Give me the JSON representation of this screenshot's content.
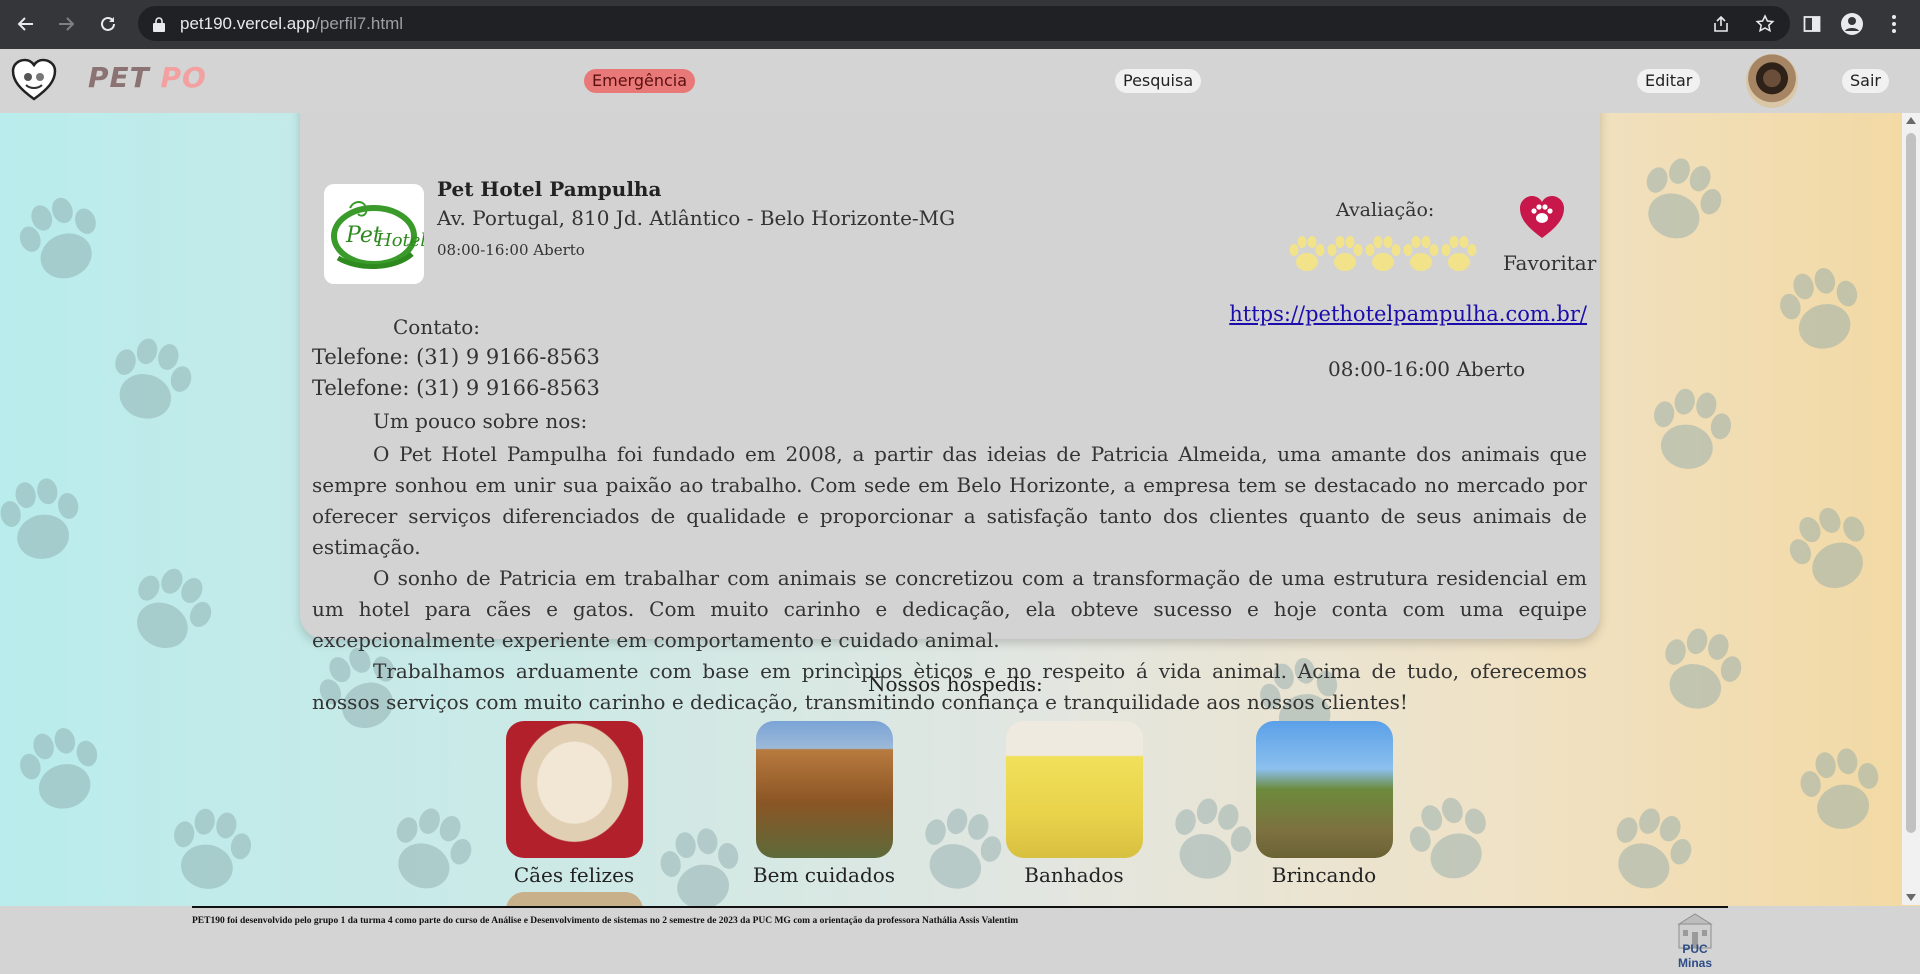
{
  "browser": {
    "url_host": "pet190.vercel.app",
    "url_path": "/perfil7.html"
  },
  "header": {
    "logo_part1": "PET",
    "logo_part2": "PO",
    "emergency": "Emergência",
    "search": "Pesquisa",
    "edit": "Editar",
    "logout": "Sair"
  },
  "profile": {
    "name": "Pet Hotel Pampulha",
    "address": "Av. Portugal, 810 Jd. Atlântico - Belo Horizonte-MG",
    "hours_small": "08:00-16:00 Aberto",
    "rating_label": "Avaliação:",
    "rating_value": 5,
    "favorite_label": "Favoritar",
    "website": "https://pethotelpampulha.com.br/",
    "hours": "08:00-16:00 Aberto",
    "contact_title": "Contato:",
    "phones": [
      "Telefone: (31) 9 9166-8563",
      "Telefone: (31) 9 9166-8563"
    ],
    "about_title": "Um pouco sobre nos:",
    "about": [
      "O Pet Hotel Pampulha foi fundado em 2008, a partir das ideias de Patricia Almeida, uma amante dos animais que sempre sonhou em unir sua paixão ao trabalho. Com sede em Belo Horizonte, a empresa tem se destacado no mercado por oferecer serviços diferenciados de qualidade e proporcionar a satisfação tanto dos clientes quanto de seus animais de estimação.",
      "O sonho de Patricia em trabalhar com animais se concretizou com a transformação de uma estrutura residencial em um hotel para cães e gatos. Com muito carinho e dedicação, ela obteve sucesso e hoje conta com uma equipe excepcionalmente experiente em comportamento e cuidado animal.",
      "Trabalhamos arduamente com base em princìpios èticos e no respeito á vida animal. Acima de tudo, oferecemos nossos serviços com muito carinho e dedicação, transmitindo confiança e tranquilidade aos nossos clientes!"
    ]
  },
  "guests": {
    "title": "Nossos hóspedis:",
    "items": [
      {
        "caption": "Cães felizes"
      },
      {
        "caption": "Bem cuidados"
      },
      {
        "caption": "Banhados"
      },
      {
        "caption": "Brincando"
      }
    ]
  },
  "footer": {
    "text": "PET190 foi desenvolvido pelo grupo 1 da turma 4 como parte do curso de Análise e Desenvolvimento de sistemas no 2 semestre de 2023 da PUC MG com a orientação da professora Nathália Assis Valentim",
    "logo_label": "PUC Minas"
  },
  "colors": {
    "chrome": "#35363a",
    "header": "#d4d4d4",
    "card": "#d3d3d3",
    "emergency": "#e97878",
    "link": "#1a0dab",
    "heart": "#c8174a",
    "paw_star": "#f2e38a"
  }
}
